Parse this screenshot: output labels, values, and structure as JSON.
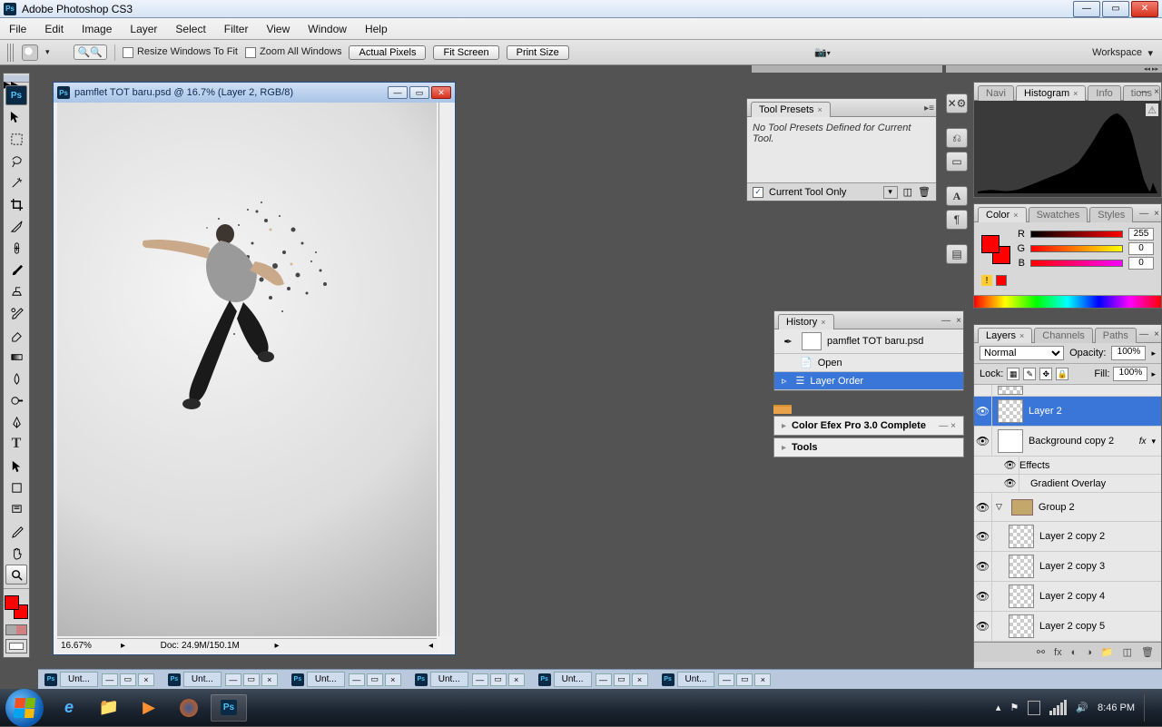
{
  "app": {
    "title": "Adobe Photoshop CS3",
    "logo": "Ps"
  },
  "menu": [
    "File",
    "Edit",
    "Image",
    "Layer",
    "Select",
    "Filter",
    "View",
    "Window",
    "Help"
  ],
  "options": {
    "resize_to_fit": "Resize Windows To Fit",
    "zoom_all": "Zoom All Windows",
    "actual_pixels": "Actual Pixels",
    "fit_screen": "Fit Screen",
    "print_size": "Print Size",
    "workspace": "Workspace"
  },
  "document": {
    "title": "pamflet TOT baru.psd @ 16.7% (Layer 2, RGB/8)",
    "zoom": "16.67%",
    "docsize": "Doc: 24.9M/150.1M"
  },
  "toolpresets": {
    "tab": "Tool Presets",
    "empty": "No Tool Presets Defined for Current Tool.",
    "current_only": "Current Tool Only"
  },
  "nav_tabs": {
    "navigator": "Navi",
    "histogram": "Histogram",
    "info": "Info",
    "actions": "tions"
  },
  "color": {
    "tabs": {
      "color": "Color",
      "swatches": "Swatches",
      "styles": "Styles"
    },
    "r": "R",
    "g": "G",
    "b": "B",
    "r_val": "255",
    "g_val": "0",
    "b_val": "0"
  },
  "history": {
    "tab": "History",
    "doc": "pamflet TOT baru.psd",
    "steps": [
      "Open",
      "Layer Order"
    ]
  },
  "extras": {
    "efex": "Color Efex Pro 3.0 Complete",
    "tools": "Tools"
  },
  "layers": {
    "tabs": {
      "layers": "Layers",
      "channels": "Channels",
      "paths": "Paths"
    },
    "blend": "Normal",
    "opacity_lbl": "Opacity:",
    "opacity": "100%",
    "lock_lbl": "Lock:",
    "fill_lbl": "Fill:",
    "fill": "100%",
    "effects": "Effects",
    "grad": "Gradient Overlay",
    "items": [
      {
        "name": "Layer 2",
        "sel": true
      },
      {
        "name": "Background copy 2",
        "fx": true
      },
      {
        "name": "Group 2",
        "group": true
      },
      {
        "name": "Layer 2 copy 2",
        "in_group": true
      },
      {
        "name": "Layer 2 copy 3",
        "in_group": true
      },
      {
        "name": "Layer 2 copy 4",
        "in_group": true
      },
      {
        "name": "Layer 2 copy 5",
        "in_group": true
      }
    ]
  },
  "docbar": {
    "label": "Unt..."
  },
  "taskbar": {
    "time": "8:46 PM"
  }
}
